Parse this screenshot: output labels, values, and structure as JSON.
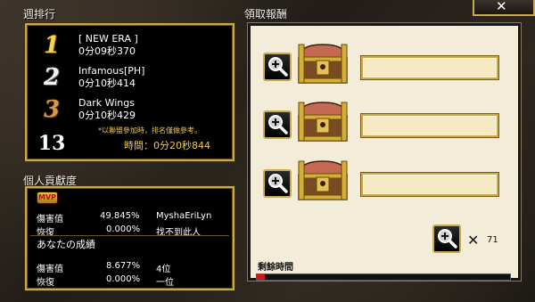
{
  "weekly_ranking": {
    "title": "週排行",
    "entries": [
      {
        "rank": "1",
        "team": "[ NEW ERA ]",
        "time": "0分09秒370"
      },
      {
        "rank": "2",
        "team": "Infamous[PH]",
        "time": "0分10秒414"
      },
      {
        "rank": "3",
        "team": "Dark Wings",
        "time": "0分10秒429"
      }
    ],
    "own_rank": "13",
    "note": "*以聯盟參加時，排名僅做參考。",
    "own_time": "時間：0分20秒844"
  },
  "contribution": {
    "title": "個人貢獻度",
    "mvp_badge": "MVP",
    "mvp_rows": [
      {
        "label": "傷害值",
        "value": "49.845%",
        "extra": "MyshaEriLyn"
      },
      {
        "label": "恢復",
        "value": "0.000%",
        "extra": "找不到此人"
      }
    ],
    "your_results_title": "あなたの成績",
    "your_rows": [
      {
        "label": "傷害值",
        "value": "8.677%",
        "extra": "4位"
      },
      {
        "label": "恢復",
        "value": "0.000%",
        "extra": "一位"
      }
    ]
  },
  "rewards": {
    "title": "領取報酬",
    "slots": [
      {
        "icon": "treasure-chest-icon",
        "value": ""
      },
      {
        "icon": "treasure-chest-icon",
        "value": ""
      },
      {
        "icon": "treasure-chest-icon",
        "value": ""
      }
    ],
    "count_symbol": "✕",
    "count": "71",
    "remaining_label": "剩餘時間",
    "remaining_progress": 0.03
  },
  "close_label": "✕"
}
